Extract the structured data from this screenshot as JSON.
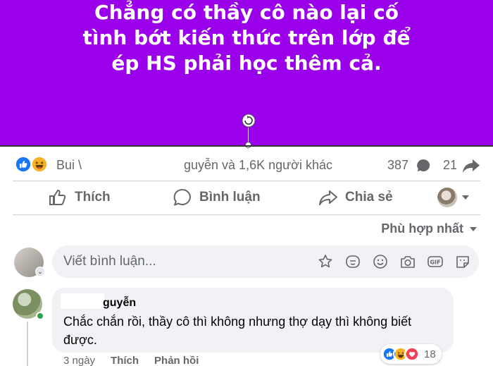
{
  "post": {
    "banner_lines": [
      "Chẳng có thầy cô nào lại cố",
      "tình bớt kiến thức trên lớp để",
      "ép HS phải học thêm cả."
    ],
    "banner_color": "#9b00ea",
    "reactions_left": "Bui \\",
    "reactions_right": "guyễn và 1,6K người khác",
    "comment_count": "387",
    "share_count": "21",
    "reaction_icons": [
      "like-icon",
      "haha-icon"
    ]
  },
  "actions": {
    "like": "Thích",
    "comment": "Bình luận",
    "share": "Chia sẻ"
  },
  "sort": {
    "label": "Phù hợp nhất"
  },
  "composer": {
    "placeholder": "Viết bình luận...",
    "tool_icons": [
      "sticker-avatar-icon",
      "gif-sticker-icon",
      "emoji-icon",
      "camera-icon",
      "gif-icon",
      "sticker-icon"
    ]
  },
  "comment": {
    "author": "guyễn",
    "text": "Chắc chắn rồi, thầy cô thì không nhưng thợ dạy thì không biết được.",
    "reaction_count": "18",
    "reaction_icons": [
      "like-icon",
      "haha-icon",
      "love-icon"
    ],
    "time": "3 ngày",
    "like_label": "Thích",
    "reply_label": "Phản hồi"
  },
  "colors": {
    "like_blue": "#1877f2",
    "muted_text": "#65676b",
    "bubble_bg": "#f0f2f5",
    "love_red": "#f33e58",
    "haha_yellow": "#f7b125"
  }
}
